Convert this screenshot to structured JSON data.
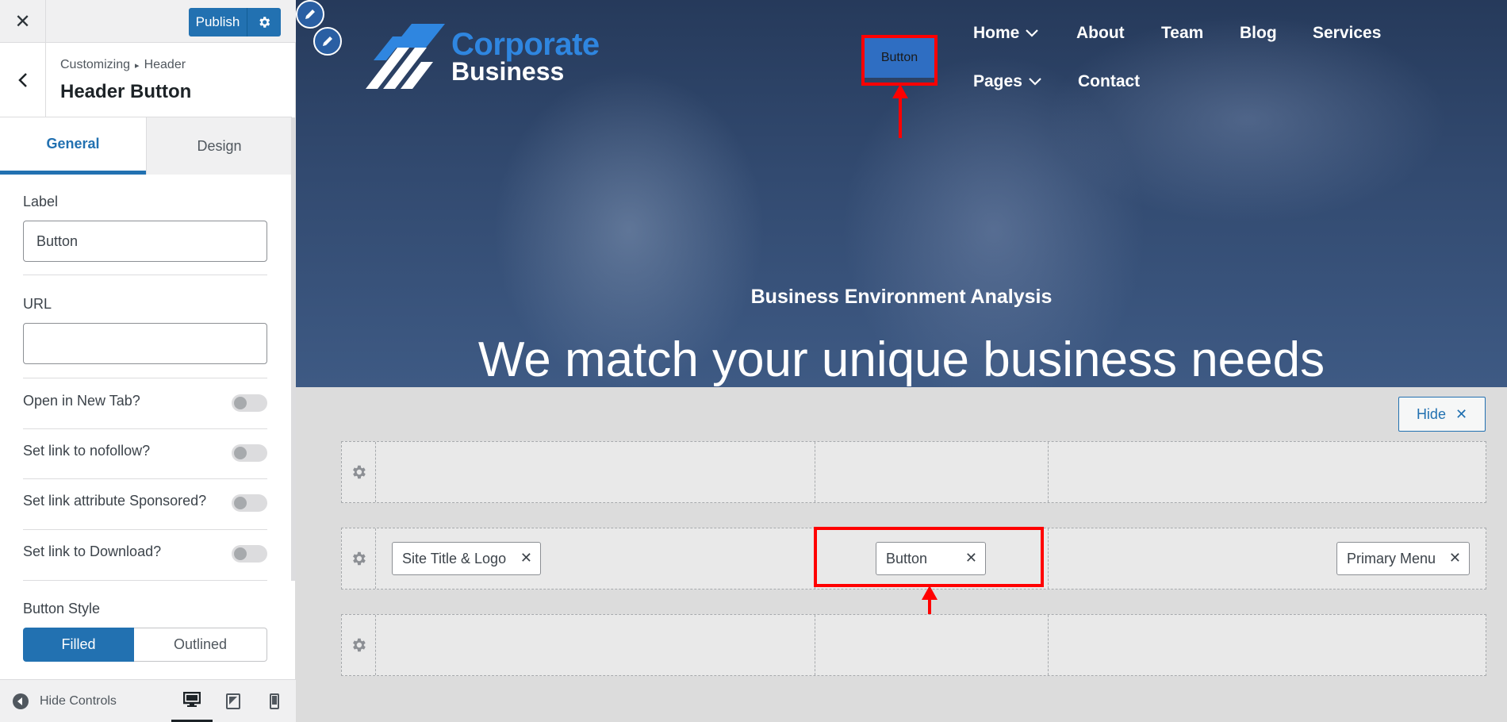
{
  "topbar": {
    "close_glyph": "✕",
    "publish_label": "Publish"
  },
  "section": {
    "breadcrumb_root": "Customizing",
    "breadcrumb_sep": "▸",
    "breadcrumb_leaf": "Header",
    "title": "Header Button"
  },
  "tabs": [
    {
      "label": "General"
    },
    {
      "label": "Design"
    }
  ],
  "fields": {
    "label": {
      "title": "Label",
      "value": "Button"
    },
    "url": {
      "title": "URL",
      "value": ""
    },
    "toggles": [
      {
        "label": "Open in New Tab?",
        "on": false
      },
      {
        "label": "Set link to nofollow?",
        "on": false
      },
      {
        "label": "Set link attribute Sponsored?",
        "on": false
      },
      {
        "label": "Set link to Download?",
        "on": false
      }
    ],
    "button_style": {
      "title": "Button Style",
      "options": [
        "Filled",
        "Outlined"
      ],
      "selected": "Filled"
    }
  },
  "footer": {
    "hide_controls_label": "Hide Controls",
    "devices": [
      "desktop-icon",
      "tablet-icon",
      "mobile-icon"
    ],
    "active_device": "desktop"
  },
  "preview": {
    "logo": {
      "line1": "Corporate",
      "line2": "Business"
    },
    "header_button_label": "Button",
    "nav": [
      {
        "label": "Home",
        "has_dropdown": true
      },
      {
        "label": "About"
      },
      {
        "label": "Team"
      },
      {
        "label": "Blog"
      },
      {
        "label": "Services"
      },
      {
        "label": "Pages",
        "has_dropdown": true
      },
      {
        "label": "Contact"
      }
    ],
    "hero_subtitle": "Business Environment Analysis",
    "hero_title": "We match your unique business needs"
  },
  "builder": {
    "hide_label": "Hide",
    "hide_glyph": "✕",
    "chips": {
      "site_title_logo": "Site Title & Logo",
      "button": "Button",
      "primary_menu": "Primary Menu"
    },
    "chip_remove_glyph": "✕"
  },
  "colors": {
    "accent": "#2271b1",
    "highlight": "#ff0000",
    "logo_blue": "#2f86e0"
  }
}
